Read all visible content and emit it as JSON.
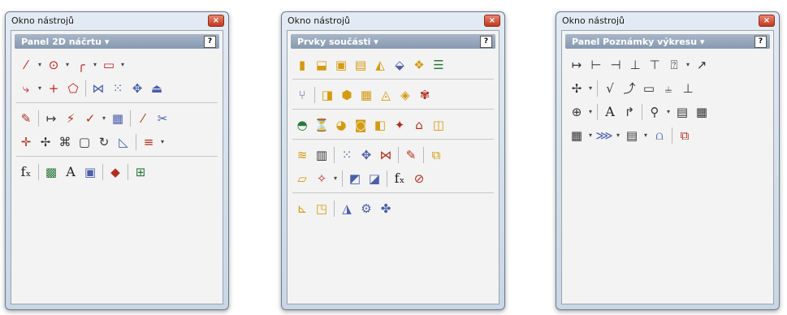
{
  "windows": [
    {
      "title": "Okno nástrojů",
      "close": "×",
      "panel": "Panel 2D náčrtu ▾",
      "help": "?",
      "groups": [
        [
          [
            {
              "g": "⁄",
              "c": "#c02020"
            },
            {
              "d": "▾"
            },
            {
              "g": "⊙",
              "c": "#c02020"
            },
            {
              "d": "▾"
            },
            {
              "g": "╭",
              "c": "#c02020"
            },
            {
              "d": "▾"
            },
            {
              "g": "▭",
              "c": "#c02020"
            },
            {
              "d": "▾"
            }
          ],
          [
            {
              "g": "⤷",
              "c": "#c02020"
            },
            {
              "d": "▾"
            },
            {
              "g": "+",
              "c": "#c02020"
            },
            {
              "g": "⬠",
              "c": "#c02020"
            },
            {
              "s": 1
            },
            {
              "g": "⋈",
              "c": "#4a60a8"
            },
            {
              "g": "⁙",
              "c": "#4a60a8"
            },
            {
              "g": "✥",
              "c": "#4a60a8"
            },
            {
              "g": "⏏",
              "c": "#4a60a8"
            }
          ]
        ],
        [
          [
            {
              "g": "✎",
              "c": "#b03020"
            },
            {
              "s": 1
            },
            {
              "g": "↦",
              "c": "#333"
            },
            {
              "g": "⚡",
              "c": "#b03020"
            },
            {
              "g": "✓",
              "c": "#b03020"
            },
            {
              "d": "▾"
            },
            {
              "g": "▦",
              "c": "#4a60a8"
            },
            {
              "s": 1
            },
            {
              "g": "⁄",
              "c": "#b03020"
            },
            {
              "g": "✂",
              "c": "#4a60a8"
            }
          ],
          [
            {
              "g": "✛",
              "c": "#b03020"
            },
            {
              "g": "✢",
              "c": "#333"
            },
            {
              "g": "⌘",
              "c": "#333"
            },
            {
              "g": "▢",
              "c": "#333"
            },
            {
              "g": "↻",
              "c": "#333"
            },
            {
              "g": "◺",
              "c": "#4a60a8"
            },
            {
              "s": 1
            },
            {
              "g": "≡",
              "c": "#b03020"
            },
            {
              "d": "▾"
            }
          ]
        ],
        [
          [
            {
              "g": "fₓ",
              "c": "#222",
              "t": 1
            },
            {
              "s": 1
            },
            {
              "g": "▩",
              "c": "#2a7a3a"
            },
            {
              "g": "A",
              "c": "#222",
              "t": 1
            },
            {
              "g": "▣",
              "c": "#4a60a8"
            },
            {
              "s": 1
            },
            {
              "g": "◆",
              "c": "#b03020"
            },
            {
              "s": 1
            },
            {
              "g": "⊞",
              "c": "#2a7a3a"
            }
          ]
        ]
      ]
    },
    {
      "title": "Okno nástrojů",
      "close": "×",
      "panel": "Prvky součásti ▾",
      "help": "?",
      "groups": [
        [
          [
            {
              "g": "▮",
              "c": "#d49a10"
            },
            {
              "g": "⬓",
              "c": "#d49a10"
            },
            {
              "g": "▣",
              "c": "#d49a10"
            },
            {
              "g": "▤",
              "c": "#d49a10"
            },
            {
              "g": "◭",
              "c": "#d49a10"
            },
            {
              "g": "⬙",
              "c": "#4a60a8"
            },
            {
              "g": "❖",
              "c": "#d49a10"
            },
            {
              "g": "☰",
              "c": "#2a7a3a"
            }
          ]
        ],
        [
          [
            {
              "g": "⑂",
              "c": "#4a60a8"
            },
            {
              "s": 1
            },
            {
              "g": "◨",
              "c": "#d49a10"
            },
            {
              "g": "⬢",
              "c": "#d49a10"
            },
            {
              "g": "▦",
              "c": "#d49a10"
            },
            {
              "g": "◬",
              "c": "#d49a10"
            },
            {
              "g": "◈",
              "c": "#d49a10"
            },
            {
              "g": "✾",
              "c": "#b03020"
            }
          ]
        ],
        [
          [
            {
              "g": "◓",
              "c": "#2a7a3a"
            },
            {
              "g": "⏳",
              "c": "#d49a10"
            },
            {
              "g": "◕",
              "c": "#d49a10"
            },
            {
              "g": "◙",
              "c": "#d49a10"
            },
            {
              "g": "◧",
              "c": "#d49a10"
            },
            {
              "g": "✦",
              "c": "#b03020"
            },
            {
              "g": "⌂",
              "c": "#b03020"
            },
            {
              "g": "◫",
              "c": "#d49a10"
            }
          ]
        ],
        [
          [
            {
              "g": "≋",
              "c": "#d49a10"
            },
            {
              "g": "▥",
              "c": "#333"
            },
            {
              "s": 1
            },
            {
              "g": "⁙",
              "c": "#4a60a8"
            },
            {
              "g": "✥",
              "c": "#4a60a8"
            },
            {
              "g": "⋈",
              "c": "#b03020"
            },
            {
              "s": 1
            },
            {
              "g": "✎",
              "c": "#b03020"
            },
            {
              "s": 1
            },
            {
              "g": "⧉",
              "c": "#d49a10"
            }
          ],
          [
            {
              "g": "▱",
              "c": "#d49a10"
            },
            {
              "g": "✧",
              "c": "#b03020"
            },
            {
              "d": "▾"
            },
            {
              "s": 1
            },
            {
              "g": "◩",
              "c": "#4a60a8"
            },
            {
              "g": "◪",
              "c": "#4a60a8"
            },
            {
              "s": 1
            },
            {
              "g": "fₓ",
              "c": "#222",
              "t": 1
            },
            {
              "g": "⊘",
              "c": "#b03020"
            }
          ]
        ],
        [
          [
            {
              "g": "⊾",
              "c": "#d49a10"
            },
            {
              "g": "◳",
              "c": "#d49a10"
            },
            {
              "s": 1
            },
            {
              "g": "◮",
              "c": "#4a60a8"
            },
            {
              "g": "⚙",
              "c": "#4a60a8"
            },
            {
              "g": "✤",
              "c": "#4a60a8"
            }
          ]
        ]
      ]
    },
    {
      "title": "Okno nástrojů",
      "close": "×",
      "panel": "Panel Poznámky výkresu ▾",
      "help": "?",
      "groups": [
        [
          [
            {
              "g": "↦",
              "c": "#333"
            },
            {
              "g": "⊢",
              "c": "#333"
            },
            {
              "g": "⊣",
              "c": "#333"
            },
            {
              "g": "⊥",
              "c": "#333"
            },
            {
              "g": "⊤",
              "c": "#333"
            },
            {
              "g": "⍰",
              "c": "#333"
            },
            {
              "d": "▾"
            },
            {
              "g": "↗",
              "c": "#333"
            }
          ],
          [
            {
              "g": "✢",
              "c": "#333"
            },
            {
              "d": "▾"
            },
            {
              "s": 1
            },
            {
              "g": "√",
              "c": "#333"
            },
            {
              "g": "⤴",
              "c": "#333"
            },
            {
              "g": "▭",
              "c": "#333"
            },
            {
              "g": "⫨",
              "c": "#333"
            },
            {
              "g": "⊥",
              "c": "#333"
            }
          ],
          [
            {
              "g": "⊕",
              "c": "#333"
            },
            {
              "d": "▾"
            },
            {
              "s": 1
            },
            {
              "g": "A",
              "c": "#222",
              "t": 1
            },
            {
              "g": "↱",
              "c": "#333"
            },
            {
              "s": 1
            },
            {
              "g": "⚲",
              "c": "#333"
            },
            {
              "d": "▾"
            },
            {
              "g": "▤",
              "c": "#333"
            },
            {
              "g": "▦",
              "c": "#333"
            }
          ],
          [
            {
              "g": "▦",
              "c": "#333"
            },
            {
              "d": "▾"
            },
            {
              "g": "⋙",
              "c": "#4a60a8"
            },
            {
              "d": "▾"
            },
            {
              "g": "▤",
              "c": "#333"
            },
            {
              "d": "▾"
            },
            {
              "g": "⩍",
              "c": "#4a60a8"
            },
            {
              "s": 1
            },
            {
              "g": "⧉",
              "c": "#b03020"
            }
          ]
        ]
      ]
    }
  ]
}
